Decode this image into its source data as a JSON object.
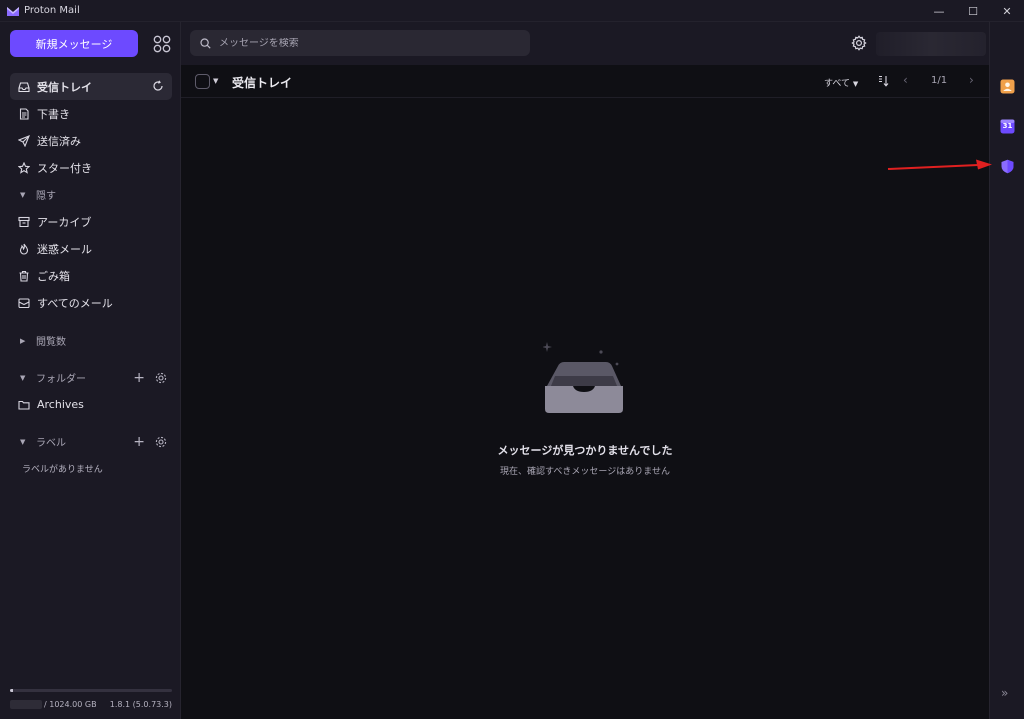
{
  "window": {
    "title": "Proton Mail",
    "controls": {
      "minimize": "—",
      "maximize": "☐",
      "close": "✕"
    }
  },
  "sidebar": {
    "new_message_label": "新規メッセージ",
    "items": [
      {
        "label": "受信トレイ",
        "icon": "inbox-icon",
        "active": true
      },
      {
        "label": "下書き",
        "icon": "draft-icon"
      },
      {
        "label": "送信済み",
        "icon": "paper-plane-icon"
      },
      {
        "label": "スター付き",
        "icon": "star-icon"
      }
    ],
    "hide_label": "隠す",
    "more_items": [
      {
        "label": "アーカイブ",
        "icon": "archive-icon"
      },
      {
        "label": "迷惑メール",
        "icon": "fire-icon"
      },
      {
        "label": "ごみ箱",
        "icon": "trash-icon"
      },
      {
        "label": "すべてのメール",
        "icon": "envelopes-icon"
      }
    ],
    "views_label": "閲覧数",
    "folders_label": "フォルダー",
    "folders": [
      {
        "label": "Archives",
        "icon": "folder-icon"
      }
    ],
    "labels_label": "ラベル",
    "no_labels_text": "ラベルがありません",
    "storage": {
      "used_fraction": 0.02,
      "total": "/ 1024.00 GB",
      "version": "1.8.1 (5.0.73.3)"
    }
  },
  "topbar": {
    "search_placeholder": "メッセージを検索"
  },
  "toolbar": {
    "folder_title": "受信トレイ",
    "filter_label": "すべて",
    "pager": "1/1",
    "prev": "‹",
    "next": "›"
  },
  "empty_state": {
    "title": "メッセージが見つかりませんでした",
    "subtitle": "現在、確認すべきメッセージはありません"
  },
  "rail": {
    "icons": [
      "contacts-icon",
      "calendar-icon",
      "vpn-shield-icon"
    ],
    "calendar_day": "31",
    "expand": "»"
  },
  "colors": {
    "accent": "#6d4aff",
    "annotation_arrow": "#e02020"
  }
}
